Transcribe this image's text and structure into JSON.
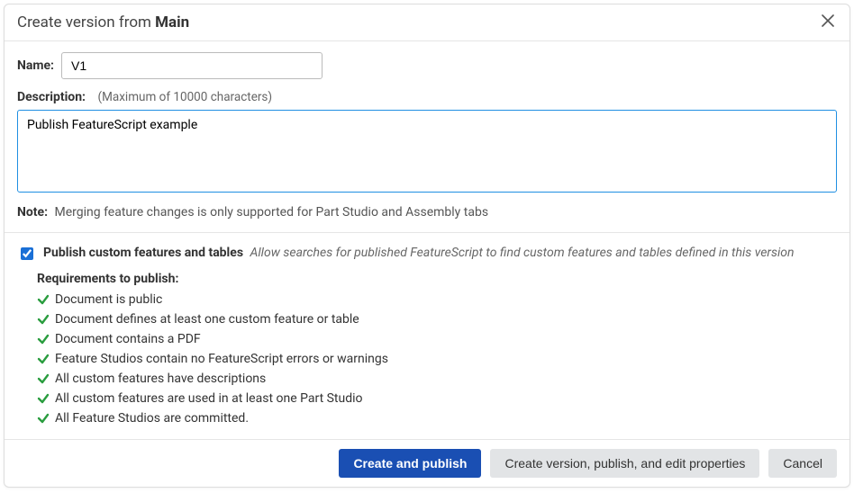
{
  "header": {
    "title_prefix": "Create version from",
    "title_value": "Main"
  },
  "fields": {
    "name_label": "Name:",
    "name_value": "V1",
    "description_label": "Description:",
    "description_hint": "(Maximum of 10000 characters)",
    "description_value": "Publish FeatureScript example",
    "note_label": "Note:",
    "note_text": "Merging feature changes is only supported for Part Studio and Assembly tabs"
  },
  "publish": {
    "checked": true,
    "label": "Publish custom features and tables",
    "description": "Allow searches for published FeatureScript to find custom features and tables defined in this version",
    "requirements_title": "Requirements to publish:",
    "requirements": [
      "Document is public",
      "Document defines at least one custom feature or table",
      "Document contains a PDF",
      "Feature Studios contain no FeatureScript errors or warnings",
      "All custom features have descriptions",
      "All custom features are used in at least one Part Studio",
      "All Feature Studios are committed."
    ]
  },
  "footer": {
    "primary": "Create and publish",
    "secondary": "Create version, publish, and edit properties",
    "cancel": "Cancel"
  }
}
